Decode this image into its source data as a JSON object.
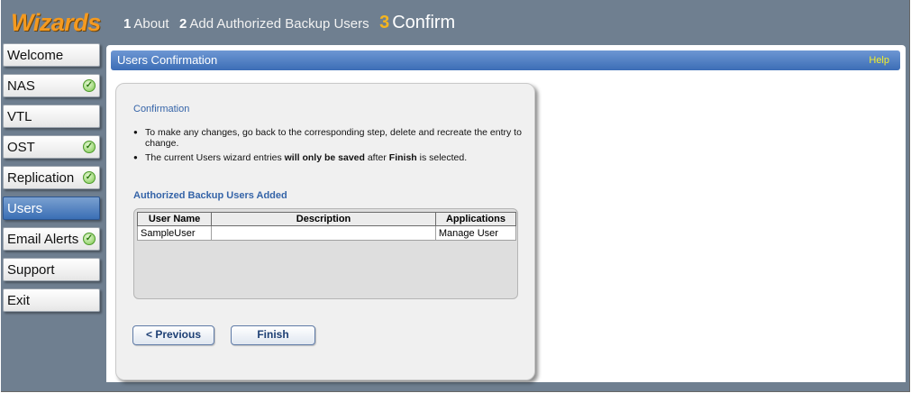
{
  "app": {
    "logo": "Wizards"
  },
  "steps": [
    {
      "num": "1",
      "label": "About"
    },
    {
      "num": "2",
      "label": "Add Authorized Backup Users"
    },
    {
      "num": "3",
      "label": "Confirm"
    }
  ],
  "sidebar": {
    "items": [
      {
        "label": "Welcome",
        "checked": false
      },
      {
        "label": "NAS",
        "checked": true
      },
      {
        "label": "VTL",
        "checked": false
      },
      {
        "label": "OST",
        "checked": true
      },
      {
        "label": "Replication",
        "checked": true
      },
      {
        "label": "Users",
        "checked": false,
        "selected": true
      },
      {
        "label": "Email Alerts",
        "checked": true
      },
      {
        "label": "Support",
        "checked": false
      },
      {
        "label": "Exit",
        "checked": false
      }
    ]
  },
  "section": {
    "title": "Users Confirmation",
    "help": "Help"
  },
  "confirmation": {
    "title": "Confirmation",
    "bullet1": "To make any changes, go back to the corresponding step, delete and recreate the entry to change.",
    "bullet2_pre": "The current Users wizard entries ",
    "bullet2_bold1": "will only be saved",
    "bullet2_mid": " after ",
    "bullet2_bold2": "Finish",
    "bullet2_post": " is selected."
  },
  "users_table": {
    "title": "Authorized Backup Users Added",
    "headers": [
      "User Name",
      "Description",
      "Applications"
    ],
    "rows": [
      {
        "user": "SampleUser",
        "description": "",
        "applications": "Manage User"
      }
    ]
  },
  "buttons": {
    "previous": "< Previous",
    "finish": "Finish"
  },
  "colors": {
    "logo": "#f59a1f",
    "accent": "#3c6db6",
    "help": "#f3ef2b",
    "frame": "#6f7f90"
  }
}
